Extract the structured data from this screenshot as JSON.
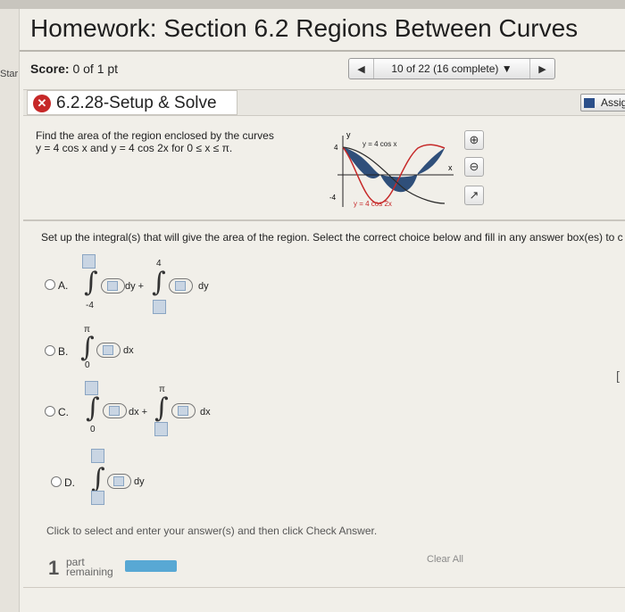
{
  "app": {
    "title": "Homework: Section 6.2 Regions Between Curves",
    "start_label": "Star"
  },
  "score": {
    "label": "Score:",
    "value": "0 of 1 pt"
  },
  "navigation": {
    "progress": "10 of 22 (16 complete) ▼"
  },
  "question": {
    "status_icon": "x-circle-icon",
    "id": "6.2.28-Setup & Solve",
    "assign_label": "Assig"
  },
  "problem": {
    "line1": "Find the area of the region enclosed by the curves",
    "line2": "y = 4 cos x and y = 4 cos 2x for 0 ≤ x ≤ π."
  },
  "graph": {
    "label_top": "y = 4 cos x",
    "label_bottom": "y = 4 cos 2x",
    "y_tick_top": "4",
    "y_tick_bottom": "-4",
    "axis_y": "y",
    "axis_x": "x",
    "curve_color": "#c62828",
    "fill_color": "#2f4f7a"
  },
  "prompt": "Set up the integral(s) that will give the area of the region. Select the correct choice below and fill in any answer box(es) to c",
  "choices": [
    {
      "letter": "A.",
      "lower1": "-4",
      "upper2": "4",
      "var1": "dy +",
      "var2": "dy"
    },
    {
      "letter": "B.",
      "upper": "π",
      "lower": "0",
      "var": "dx"
    },
    {
      "letter": "C.",
      "lower1": "0",
      "upper2": "π",
      "var1": "dx +",
      "var2": "dx"
    },
    {
      "letter": "D.",
      "var": "dy"
    }
  ],
  "instructions": "Click to select and enter your answer(s) and then click Check Answer.",
  "footer": {
    "parts_count": "1",
    "parts_text_1": "part",
    "parts_text_2": "remaining",
    "progress_fraction": 1,
    "clear_all": "Clear All"
  },
  "colors": {
    "accent": "#58a8d4",
    "error": "#c62828",
    "answer_box": "#c9d5e3"
  }
}
